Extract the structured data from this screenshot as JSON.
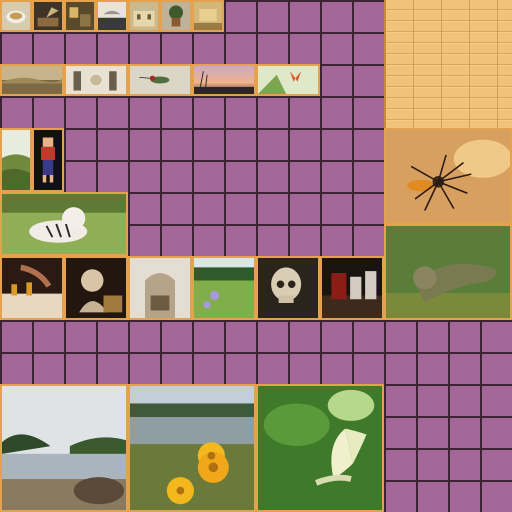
{
  "atlas": {
    "title": "",
    "background_color": "#a46898",
    "grid_color": "#3a2436",
    "frame_color": "#e4a24e"
  },
  "tiles": [
    {
      "name": "tile-pastry",
      "subject": "pastry-icon"
    },
    {
      "name": "tile-gramophone",
      "subject": "gramophone-icon"
    },
    {
      "name": "tile-kitchen",
      "subject": "kitchen-icon"
    },
    {
      "name": "tile-sink",
      "subject": "sink-icon"
    },
    {
      "name": "tile-building",
      "subject": "building-icon"
    },
    {
      "name": "tile-potted-plant",
      "subject": "potted-plant-icon"
    },
    {
      "name": "tile-room",
      "subject": "room-icon"
    },
    {
      "name": "tile-landscape-painting",
      "subject": "landscape-icon"
    },
    {
      "name": "tile-lab-figures",
      "subject": "figures-icon"
    },
    {
      "name": "tile-hummingbird",
      "subject": "hummingbird-icon"
    },
    {
      "name": "tile-sunset-grass",
      "subject": "sunset-icon"
    },
    {
      "name": "tile-butterfly-orange",
      "subject": "butterfly-icon"
    },
    {
      "name": "tile-hillside",
      "subject": "hillside-icon"
    },
    {
      "name": "tile-pixel-character",
      "subject": "pixel-character-icon"
    },
    {
      "name": "tile-white-tiger",
      "subject": "tiger-icon"
    },
    {
      "name": "tile-chess-hand",
      "subject": "chess-icon"
    },
    {
      "name": "tile-bust",
      "subject": "bust-icon"
    },
    {
      "name": "tile-interior",
      "subject": "interior-icon"
    },
    {
      "name": "tile-flowers-field",
      "subject": "flowers-icon"
    },
    {
      "name": "tile-skull",
      "subject": "skull-icon"
    },
    {
      "name": "tile-chess-rooks",
      "subject": "rooks-icon"
    },
    {
      "name": "tile-spider",
      "subject": "spider-icon"
    },
    {
      "name": "tile-iguana",
      "subject": "iguana-icon"
    },
    {
      "name": "tile-lake-shore",
      "subject": "lake-icon"
    },
    {
      "name": "tile-yellow-flowers",
      "subject": "yellow-flowers-icon"
    },
    {
      "name": "tile-white-butterfly",
      "subject": "white-butterfly-icon"
    }
  ]
}
